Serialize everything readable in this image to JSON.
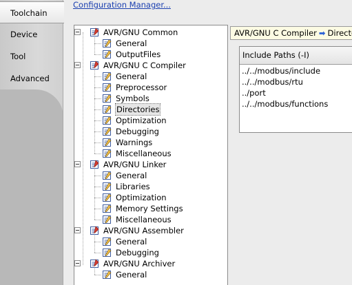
{
  "tabs": [
    "Toolchain",
    "Device",
    "Tool",
    "Advanced"
  ],
  "active_tab": "Toolchain",
  "config_link": "Configuration Manager...",
  "tree": [
    {
      "label": "AVR/GNU Common",
      "children": [
        "General",
        "OutputFiles"
      ]
    },
    {
      "label": "AVR/GNU C Compiler",
      "children": [
        "General",
        "Preprocessor",
        "Symbols",
        "Directories",
        "Optimization",
        "Debugging",
        "Warnings",
        "Miscellaneous"
      ]
    },
    {
      "label": "AVR/GNU Linker",
      "children": [
        "General",
        "Libraries",
        "Optimization",
        "Memory Settings",
        "Miscellaneous"
      ]
    },
    {
      "label": "AVR/GNU Assembler",
      "children": [
        "General",
        "Debugging"
      ]
    },
    {
      "label": "AVR/GNU Archiver",
      "children": [
        "General"
      ]
    }
  ],
  "selected": "Directories",
  "breadcrumb": {
    "parent": "AVR/GNU C Compiler",
    "arrow": "➡",
    "current": "Directories"
  },
  "include_paths": {
    "header": "Include Paths (-I)",
    "items": [
      "../../modbus/include",
      "../../modbus/rtu",
      "../port",
      "../../modbus/functions"
    ]
  },
  "colors": {
    "link": "#1a3fb0",
    "crumb_bg": "#fcfbe3",
    "arrow": "#2b62d6"
  }
}
